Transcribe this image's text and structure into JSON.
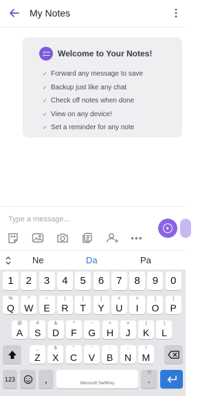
{
  "header": {
    "title": "My Notes",
    "back_icon": "arrow-left-icon",
    "more_icon": "more-vertical-icon",
    "accent": "#5c5cc8"
  },
  "welcome": {
    "title": "Welcome to Your Notes!",
    "icon": "checklist-icon",
    "icon_color": "#7c5cda",
    "items": [
      "Forward any message to save",
      "Backup just like any chat",
      "Check off notes when done",
      "View on any device!",
      "Set a reminder for any note"
    ]
  },
  "composer": {
    "placeholder": "Type a message...",
    "send_color": "#8b63e6",
    "tools": [
      "sticker-icon",
      "image-icon",
      "camera-icon",
      "copy-icon",
      "add-contact-icon",
      "more-horizontal-icon"
    ]
  },
  "suggestions": {
    "toggle_icon": "expand-collapse-icon",
    "words": [
      "Ne",
      "Da",
      "Pa"
    ],
    "selected": "Da"
  },
  "keyboard": {
    "numbers": [
      "1",
      "2",
      "3",
      "4",
      "5",
      "6",
      "7",
      "8",
      "9",
      "0"
    ],
    "row1": [
      {
        "k": "Q",
        "s": "%"
      },
      {
        "k": "W",
        "s": "^"
      },
      {
        "k": "E",
        "s": "~"
      },
      {
        "k": "R",
        "s": "|"
      },
      {
        "k": "T",
        "s": "["
      },
      {
        "k": "Y",
        "s": "]"
      },
      {
        "k": "U",
        "s": "<"
      },
      {
        "k": "I",
        "s": ">"
      },
      {
        "k": "O",
        "s": "{"
      },
      {
        "k": "P",
        "s": "}"
      }
    ],
    "row2": [
      {
        "k": "A",
        "s": "@"
      },
      {
        "k": "S",
        "s": "#"
      },
      {
        "k": "D",
        "s": "&"
      },
      {
        "k": "F",
        "s": "*"
      },
      {
        "k": "G",
        "s": "-"
      },
      {
        "k": "H",
        "s": "+"
      },
      {
        "k": "J",
        "s": "="
      },
      {
        "k": "K",
        "s": "("
      },
      {
        "k": "L",
        "s": ")"
      }
    ],
    "row3": [
      {
        "k": "Z",
        "s": "_"
      },
      {
        "k": "X",
        "s": "$"
      },
      {
        "k": "C",
        "s": "\""
      },
      {
        "k": "V",
        "s": "'"
      },
      {
        "k": "B",
        "s": ":"
      },
      {
        "k": "N",
        "s": ";"
      },
      {
        "k": "M",
        "s": "/"
      }
    ],
    "shift_icon": "shift-icon",
    "backspace_icon": "backspace-icon",
    "mode_label": "123",
    "emoji_icon": "emoji-icon",
    "comma": ",",
    "space_label": "Microsoft SwiftKey",
    "period": ".",
    "period_sub": "?!",
    "enter_icon": "enter-icon",
    "enter_color": "#2f7ad9"
  }
}
